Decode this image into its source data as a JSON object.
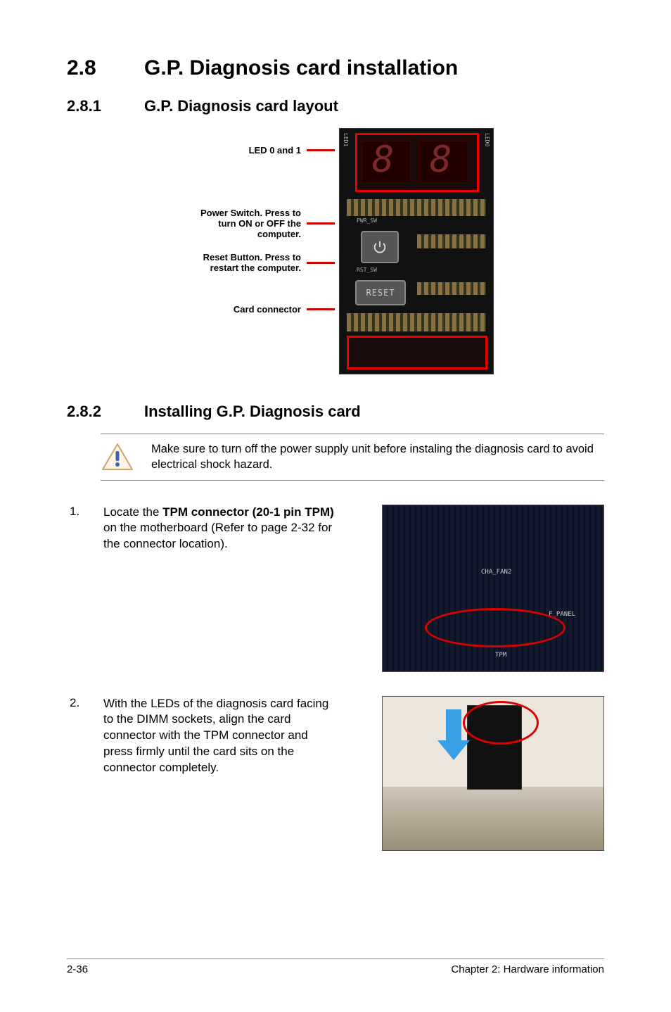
{
  "heading": {
    "num": "2.8",
    "title": "G.P. Diagnosis card installation"
  },
  "sec1": {
    "num": "2.8.1",
    "title": "G.P. Diagnosis card layout",
    "labels": {
      "led": "LED 0 and 1",
      "power": "Power Switch. Press to turn ON or OFF the computer.",
      "reset": "Reset Button. Press to restart the computer.",
      "connector": "Card connector"
    },
    "card": {
      "seg_glyph": "8",
      "reset_text": "RESET",
      "pwr_sw": "PWR_SW",
      "rst_sw": "RST_SW",
      "led0": "LED0",
      "led1": "LED1"
    }
  },
  "sec2": {
    "num": "2.8.2",
    "title": "Installing G.P. Diagnosis card",
    "warning": "Make sure to turn off the power supply unit before instaling the diagnosis card to avoid electrical shock hazard.",
    "step1": {
      "n": "1.",
      "pre": "Locate the ",
      "bold": "TPM connector (20-1 pin TPM)",
      "post": " on the motherboard (Refer to page 2-32 for the connector location).",
      "labels": {
        "cha_fan2": "CHA_FAN2",
        "f_panel": "F_PANEL",
        "tpm": "TPM"
      }
    },
    "step2": {
      "n": "2.",
      "text": "With the LEDs of the diagnosis card facing to the DIMM sockets, align the card connector with the TPM connector and press firmly until the card sits on the connector completely."
    }
  },
  "footer": {
    "left": "2-36",
    "right": "Chapter 2: Hardware information"
  }
}
